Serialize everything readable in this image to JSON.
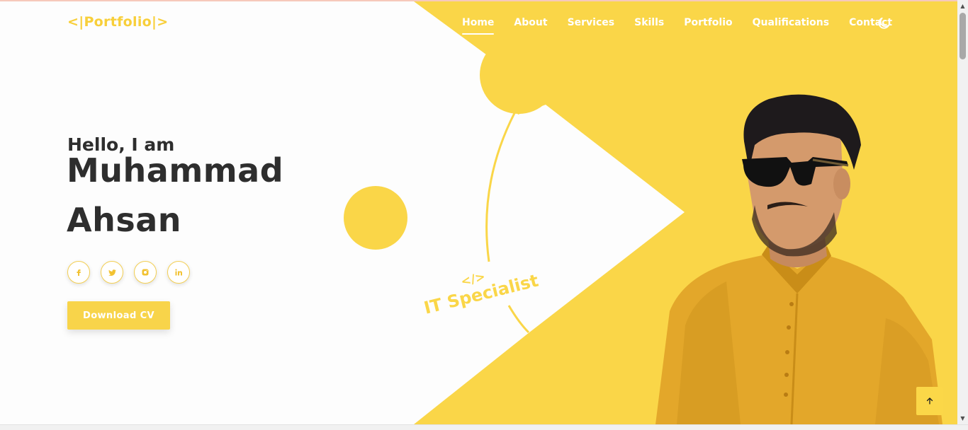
{
  "logo": "<|Portfolio|>",
  "nav": {
    "items": [
      "Home",
      "About",
      "Services",
      "Skills",
      "Portfolio",
      "Qualifications",
      "Contact"
    ],
    "active": "Home"
  },
  "hero": {
    "greeting": "Hello, I am",
    "name_line1": "Muhammad",
    "name_line2": "Ahsan",
    "role_icon": "</>",
    "role": "IT Specialist",
    "cta": "Download CV"
  },
  "socials": [
    {
      "icon": "facebook-icon",
      "glyph": "f"
    },
    {
      "icon": "twitter-icon",
      "glyph": "t"
    },
    {
      "icon": "instagram-icon",
      "glyph": "ig"
    },
    {
      "icon": "linkedin-icon",
      "glyph": "in"
    }
  ],
  "colors": {
    "accent": "#fad648",
    "text": "#2e2e2e",
    "shirt": "#e5a92a"
  }
}
